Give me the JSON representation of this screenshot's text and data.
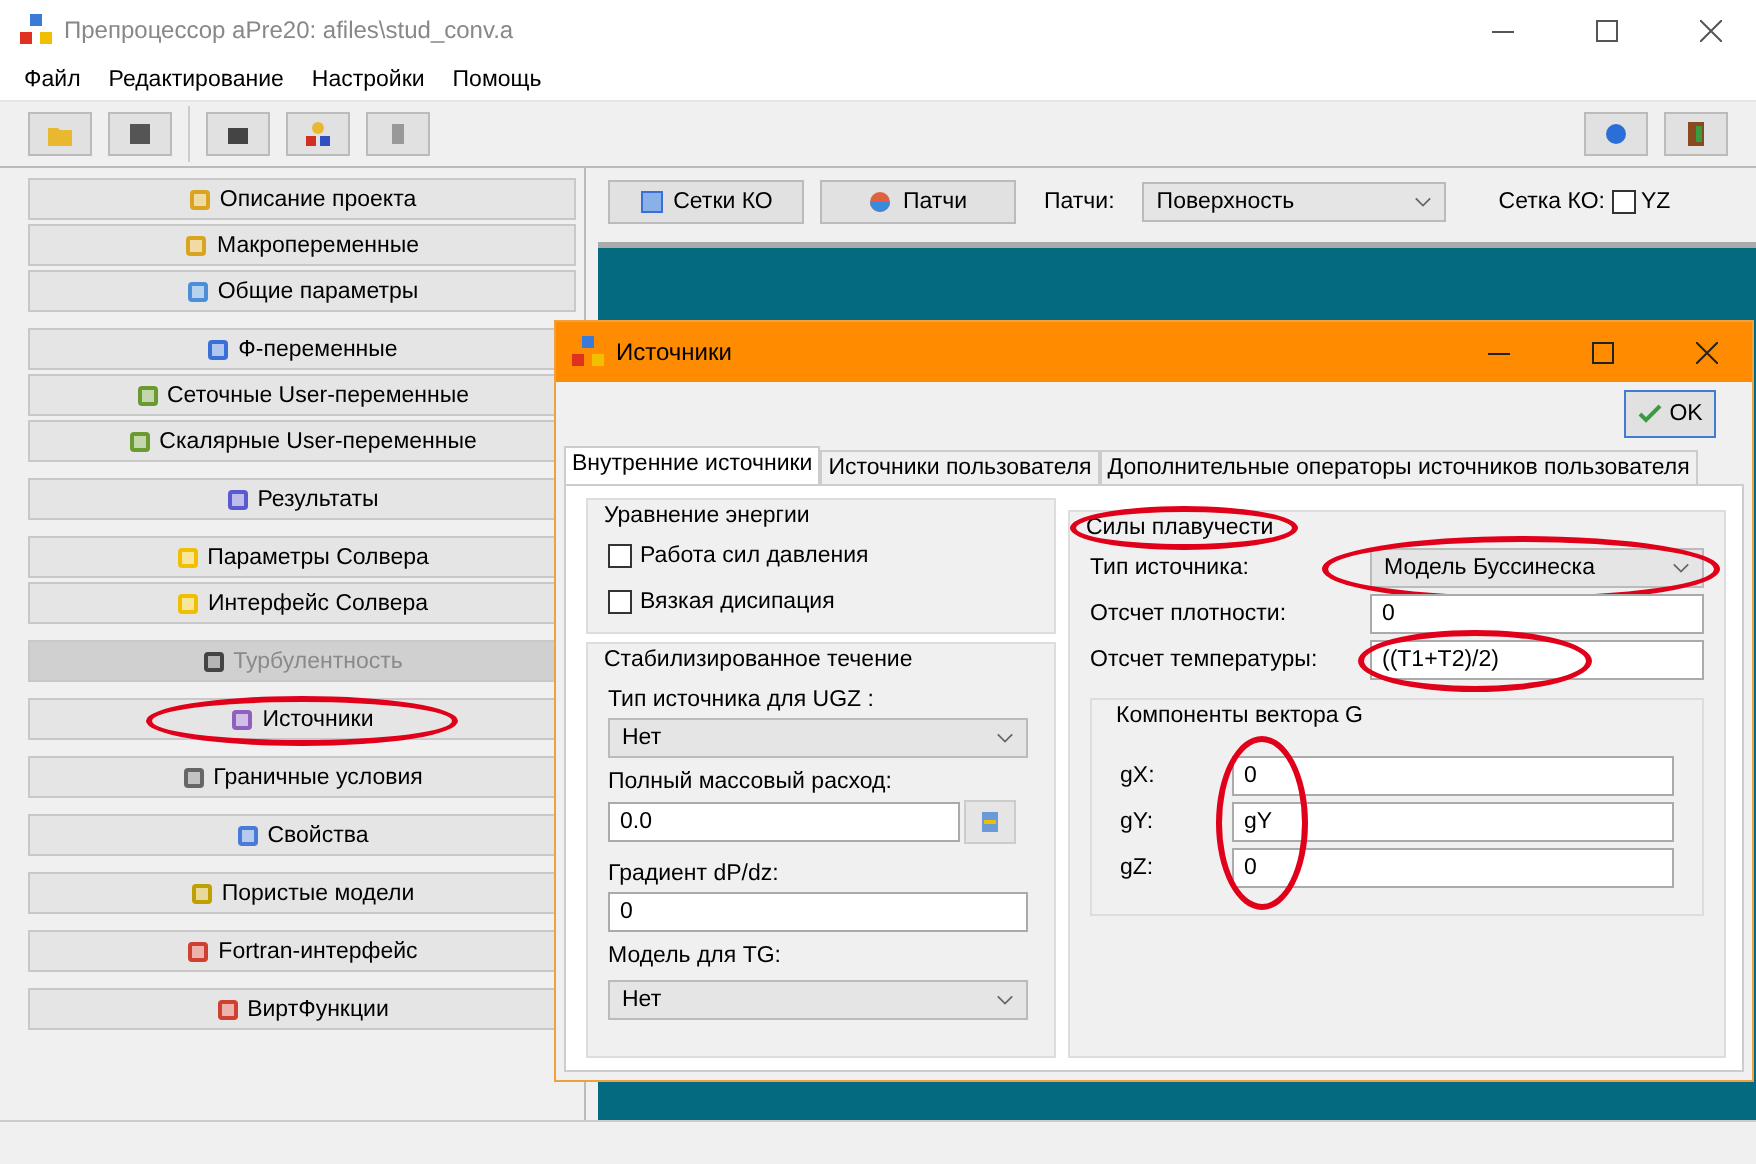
{
  "window": {
    "title": "Препроцессор aPre20: afiles\\stud_conv.a"
  },
  "menu": [
    "Файл",
    "Редактирование",
    "Настройки",
    "Помощь"
  ],
  "sidebar": {
    "groups": [
      {
        "items": [
          {
            "label": "Описание проекта",
            "disabled": false,
            "circled": false
          },
          {
            "label": "Макропеременные",
            "disabled": false,
            "circled": false
          },
          {
            "label": "Общие параметры",
            "disabled": false,
            "circled": false
          }
        ]
      },
      {
        "items": [
          {
            "label": "Ф-переменные",
            "disabled": false,
            "circled": false
          },
          {
            "label": "Сеточные User-переменные",
            "disabled": false,
            "circled": false
          },
          {
            "label": "Скалярные User-переменные",
            "disabled": false,
            "circled": false
          }
        ]
      },
      {
        "items": [
          {
            "label": "Результаты",
            "disabled": false,
            "circled": false
          }
        ]
      },
      {
        "items": [
          {
            "label": "Параметры Солвера",
            "disabled": false,
            "circled": false
          },
          {
            "label": "Интерфейс Солвера",
            "disabled": false,
            "circled": false
          }
        ]
      },
      {
        "items": [
          {
            "label": "Турбулентность",
            "disabled": true,
            "circled": false
          }
        ]
      },
      {
        "items": [
          {
            "label": "Источники",
            "disabled": false,
            "circled": true
          }
        ]
      },
      {
        "items": [
          {
            "label": "Граничные условия",
            "disabled": false,
            "circled": false
          }
        ]
      },
      {
        "items": [
          {
            "label": "Свойства",
            "disabled": false,
            "circled": false
          }
        ]
      },
      {
        "items": [
          {
            "label": "Пористые модели",
            "disabled": false,
            "circled": false
          }
        ]
      },
      {
        "items": [
          {
            "label": "Fortran-интерфейс",
            "disabled": false,
            "circled": false
          }
        ]
      },
      {
        "items": [
          {
            "label": "ВиртФункции",
            "disabled": false,
            "circled": false
          }
        ]
      }
    ]
  },
  "view_toolbar": {
    "buttons": [
      "Сетки КО",
      "Патчи"
    ],
    "patches_label": "Патчи:",
    "patches_value": "Поверхность",
    "grid_label": "Сетка КО:",
    "yz": {
      "label": "YZ",
      "checked": false
    }
  },
  "dialog": {
    "title": "Источники",
    "ok": "OK",
    "tabs": [
      {
        "label": "Внутренние источники",
        "selected": true
      },
      {
        "label": "Источники пользователя",
        "selected": false
      },
      {
        "label": "Дополнительные операторы источников пользователя",
        "selected": false
      }
    ],
    "energy": {
      "title": "Уравнение энергии",
      "checks": [
        {
          "label": "Работа сил давления",
          "checked": false
        },
        {
          "label": "Вязкая дисипация",
          "checked": false
        }
      ]
    },
    "stabilized": {
      "title": "Стабилизированное течение",
      "ugz_label": "Тип источника для UGZ :",
      "ugz_value": "Нет",
      "flow_label": "Полный массовый расход:",
      "flow_value": "0.0",
      "gradient_label": "Градиент dP/dz:",
      "gradient_value": "0",
      "tg_label": "Модель для TG:",
      "tg_value": "Нет"
    },
    "buoyancy": {
      "title": "Силы плавучести",
      "title_circled": true,
      "fields": [
        {
          "kind": "dropdown",
          "label": "Тип источника:",
          "value": "Модель Буссинеска",
          "circled": true
        },
        {
          "kind": "input",
          "label": "Отсчет плотности:",
          "value": "0",
          "circled": false
        },
        {
          "kind": "input",
          "label": "Отсчет температуры:",
          "value": "((T1+T2)/2)",
          "circled": true
        }
      ],
      "vector": {
        "title": "Компоненты вектора G",
        "values_circled": true,
        "components": [
          {
            "label": "gX:",
            "value": "0"
          },
          {
            "label": "gY:",
            "value": "gY"
          },
          {
            "label": "gZ:",
            "value": "0"
          }
        ]
      }
    }
  }
}
